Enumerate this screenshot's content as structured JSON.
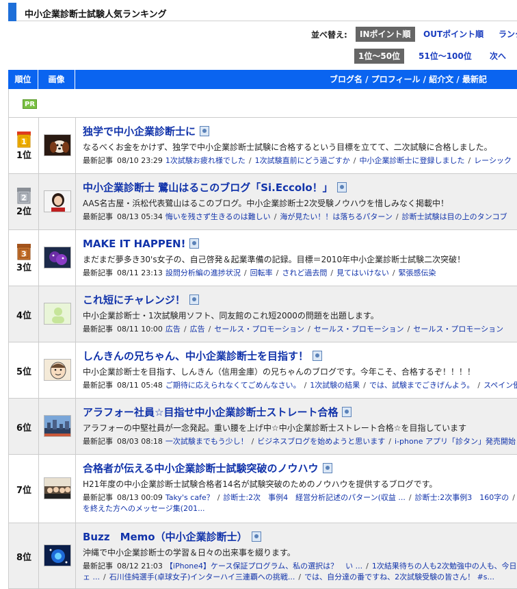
{
  "page": {
    "title": "中小企業診断士試験人気ランキング"
  },
  "sort": {
    "label": "並べ替え:",
    "options": [
      {
        "label": "INポイント順",
        "active": true
      },
      {
        "label": "OUTポイント順",
        "active": false
      },
      {
        "label": "ランク",
        "active": false
      }
    ]
  },
  "pagination": {
    "items": [
      {
        "label": "1位～50位",
        "active": true
      },
      {
        "label": "51位～100位",
        "active": false
      },
      {
        "label": "次へ",
        "active": false
      }
    ]
  },
  "table": {
    "headers": {
      "rank": "順位",
      "image": "画像",
      "blog": "ブログ名 / プロフィール   / 紹介文 / 最新記"
    },
    "pr_badge": "PR",
    "recent_label": "最新記事",
    "rows": [
      {
        "rank": "1位",
        "medal": "gold",
        "medal_num": "1",
        "thumb": "dog-thumbnail",
        "title": "独学で中小企業診断士に",
        "desc": "なるべくお金をかけず、独学で中小企業診断士試験に合格するという目標を立てて、二次試験に合格しました。",
        "date": "08/10 23:29",
        "articles": [
          "1次試験お疲れ様でした",
          "1次試験直前にどう過ごすか",
          "中小企業診断士に登録しました",
          "レーシック"
        ],
        "articles2": []
      },
      {
        "rank": "2位",
        "medal": "silver",
        "medal_num": "2",
        "thumb": "woman-portrait",
        "title": "中小企業診断士 鷺山はるこのブログ「Si.Eccolo！」",
        "desc": "AAS名古屋・浜松代表鷺山はるこのブログ。中小企業診断士2次受験ノウハウを惜しみなく掲載中！",
        "date": "08/13 05:34",
        "articles": [
          "悔いを残さず生きるのは難しい",
          "海が見たい！！は落ちるパターン",
          "診断士試験は目の上のタンコブ"
        ],
        "articles2": []
      },
      {
        "rank": "3位",
        "medal": "bronze",
        "medal_num": "3",
        "thumb": "purple-plush",
        "title": "MAKE IT HAPPEN!",
        "desc": "まだまだ夢多き30's女子の、自己啓発＆起業準備の記録。目標＝2010年中小企業診断士試験二次突破！",
        "date": "08/11 23:13",
        "articles": [
          "設問分析編の進捗状況",
          "回転率",
          "されど過去問",
          "見てはいけない",
          "緊張感伝染"
        ],
        "articles2": []
      },
      {
        "rank": "4位",
        "medal": "",
        "medal_num": "",
        "thumb": "default-avatar",
        "title": "これ短にチャレンジ！",
        "desc": "中小企業診断士・1次試験用ソフト、同友館のこれ短2000の問題を出題します。",
        "date": "08/11 10:00",
        "articles": [
          "広告",
          "広告",
          "セールス・プロモーション",
          "セールス・プロモーション",
          "セールス・プロモーション"
        ],
        "articles2": []
      },
      {
        "rank": "5位",
        "medal": "",
        "medal_num": "",
        "thumb": "illustrated-face",
        "title": "しんきんの兄ちゃん、中小企業診断士を目指す！",
        "desc": "中小企業診断士を目指す、しんきん（信用金庫）の兄ちゃんのブログです。今年こそ、合格するぞ！！！！",
        "date": "08/11 05:48",
        "articles": [
          "ご期待に応えられなくてごめんなさい。",
          "1次試験の結果",
          "では、試験までごきげんよう。",
          "スペイン優"
        ],
        "articles2": []
      },
      {
        "rank": "6位",
        "medal": "",
        "medal_num": "",
        "thumb": "city-skyline",
        "title": "アラフォー社員☆目指せ中小企業診断士ストレート合格",
        "desc": "アラフォーの中堅社員が一念発起。重い腰を上げ中☆中小企業診断士ストレート合格☆を目指しています",
        "date": "08/03 08:18",
        "articles": [
          "一次試験までもう少し！",
          "ビジネスブログを始めようと思います",
          "i-phone アプリ「診タン」発売開始！"
        ],
        "articles2": []
      },
      {
        "rank": "7位",
        "medal": "",
        "medal_num": "",
        "thumb": "group-photo",
        "title": "合格者が伝える中小企業診断士試験突破のノウハウ",
        "desc": "H21年度の中小企業診断士試験合格者14名が試験突破のためのノウハウを提供するブログです。",
        "date": "08/13 00:09",
        "articles": [
          "Taky's cafe？",
          "診断士:2次　事例4　経営分析記述のパターン(収益 ...",
          "診断士:2次事例3　160字の"
        ],
        "articles2": [
          "を終えた方へのメッセージ集(201..."
        ]
      },
      {
        "rank": "8位",
        "medal": "",
        "medal_num": "",
        "thumb": "blue-sparkle",
        "title": "Buzz　Memo（中小企業診断士）",
        "desc": "沖縄で中小企業診断士の学習＆日々の出来事を綴ります。",
        "date": "08/12 21:03",
        "articles": [
          "【iPhone4】ケース保証プログラム、私の選択は？　い ...",
          "1次結果待ちの人も2次勉強中の人も、今日は"
        ],
        "articles2": [
          "ェ ...",
          "石川佳純選手(卓球女子)インターハイ三連覇への挑戦...",
          "では、自分達の番ですね、2次試験受験の皆さん！ #s..."
        ]
      }
    ]
  },
  "colors": {
    "accent": "#1e6fd9",
    "header_bg": "#0a64f0",
    "link": "#1133aa",
    "active_tab": "#666666",
    "pr_green": "#7ac043"
  }
}
